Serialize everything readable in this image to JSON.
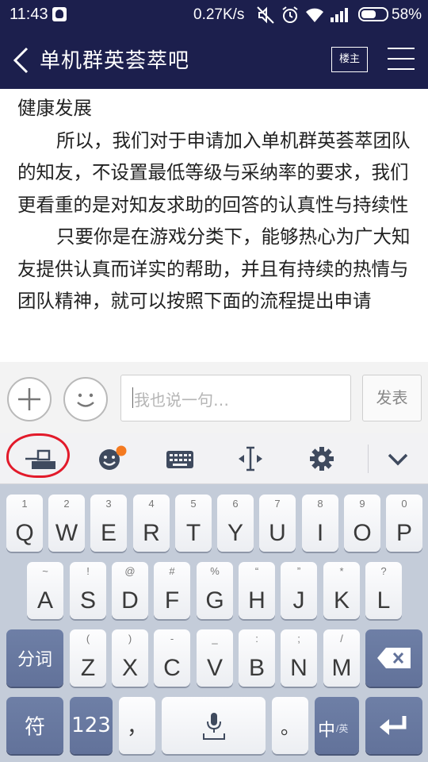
{
  "status_bar": {
    "time": "11:43",
    "net_speed": "0.27K/s",
    "battery": "58%"
  },
  "nav": {
    "title": "单机群英荟萃吧",
    "louzhu_button": "楼主"
  },
  "article": {
    "paragraphs": [
      "健康发展",
      "所以，我们对于申请加入单机群英荟萃团队的知友，不设置最低等级与采纳率的要求，我们更看重的是对知友求助的回答的认真性与持续性",
      "只要你是在游戏分类下，能够热心为广大知友提供认真而详实的帮助，并且有持续的热情与团队精神，就可以按照下面的流程提出申请"
    ]
  },
  "comment_bar": {
    "input_placeholder": "我也说一句…",
    "post_button": "发表"
  },
  "keyboard": {
    "row1": [
      {
        "main": "Q",
        "sub": "1"
      },
      {
        "main": "W",
        "sub": "2"
      },
      {
        "main": "E",
        "sub": "3"
      },
      {
        "main": "R",
        "sub": "4"
      },
      {
        "main": "T",
        "sub": "5"
      },
      {
        "main": "Y",
        "sub": "6"
      },
      {
        "main": "U",
        "sub": "7"
      },
      {
        "main": "I",
        "sub": "8"
      },
      {
        "main": "O",
        "sub": "9"
      },
      {
        "main": "P",
        "sub": "0"
      }
    ],
    "row2": [
      {
        "main": "A",
        "sub": "~"
      },
      {
        "main": "S",
        "sub": "!"
      },
      {
        "main": "D",
        "sub": "@"
      },
      {
        "main": "F",
        "sub": "#"
      },
      {
        "main": "G",
        "sub": "%"
      },
      {
        "main": "H",
        "sub": "“"
      },
      {
        "main": "J",
        "sub": "”"
      },
      {
        "main": "K",
        "sub": "*"
      },
      {
        "main": "L",
        "sub": "?"
      }
    ],
    "row3": [
      {
        "main": "Z",
        "sub": "("
      },
      {
        "main": "X",
        "sub": ")"
      },
      {
        "main": "C",
        "sub": "-"
      },
      {
        "main": "V",
        "sub": "_"
      },
      {
        "main": "B",
        "sub": ":"
      },
      {
        "main": "N",
        "sub": ";"
      },
      {
        "main": "M",
        "sub": "/"
      }
    ],
    "fenci": "分词",
    "fu": "符",
    "num": "123",
    "comma": "，",
    "period": "。",
    "lang_zh": "中",
    "lang_en": "/英"
  },
  "colors": {
    "nav_bg": "#1c1f4d",
    "keyboard_bg": "#c4ccd9",
    "dark_key": "#6e7fa6",
    "annotation_red": "#e21a2a",
    "emoji_badge": "#f47a20"
  },
  "icons": {
    "back": "chevron-left-icon",
    "menu": "hamburger-icon",
    "add": "plus-icon",
    "emoji": "smiley-icon",
    "kb_switch": "keyboard-switch-icon",
    "kb_emoji": "emoji-icon",
    "kb_keyboard": "keyboard-icon",
    "kb_cursor": "cursor-move-icon",
    "kb_settings": "gear-icon",
    "kb_hide": "chevron-down-icon",
    "voice": "microphone-icon",
    "backspace": "backspace-icon",
    "enter": "enter-icon"
  }
}
